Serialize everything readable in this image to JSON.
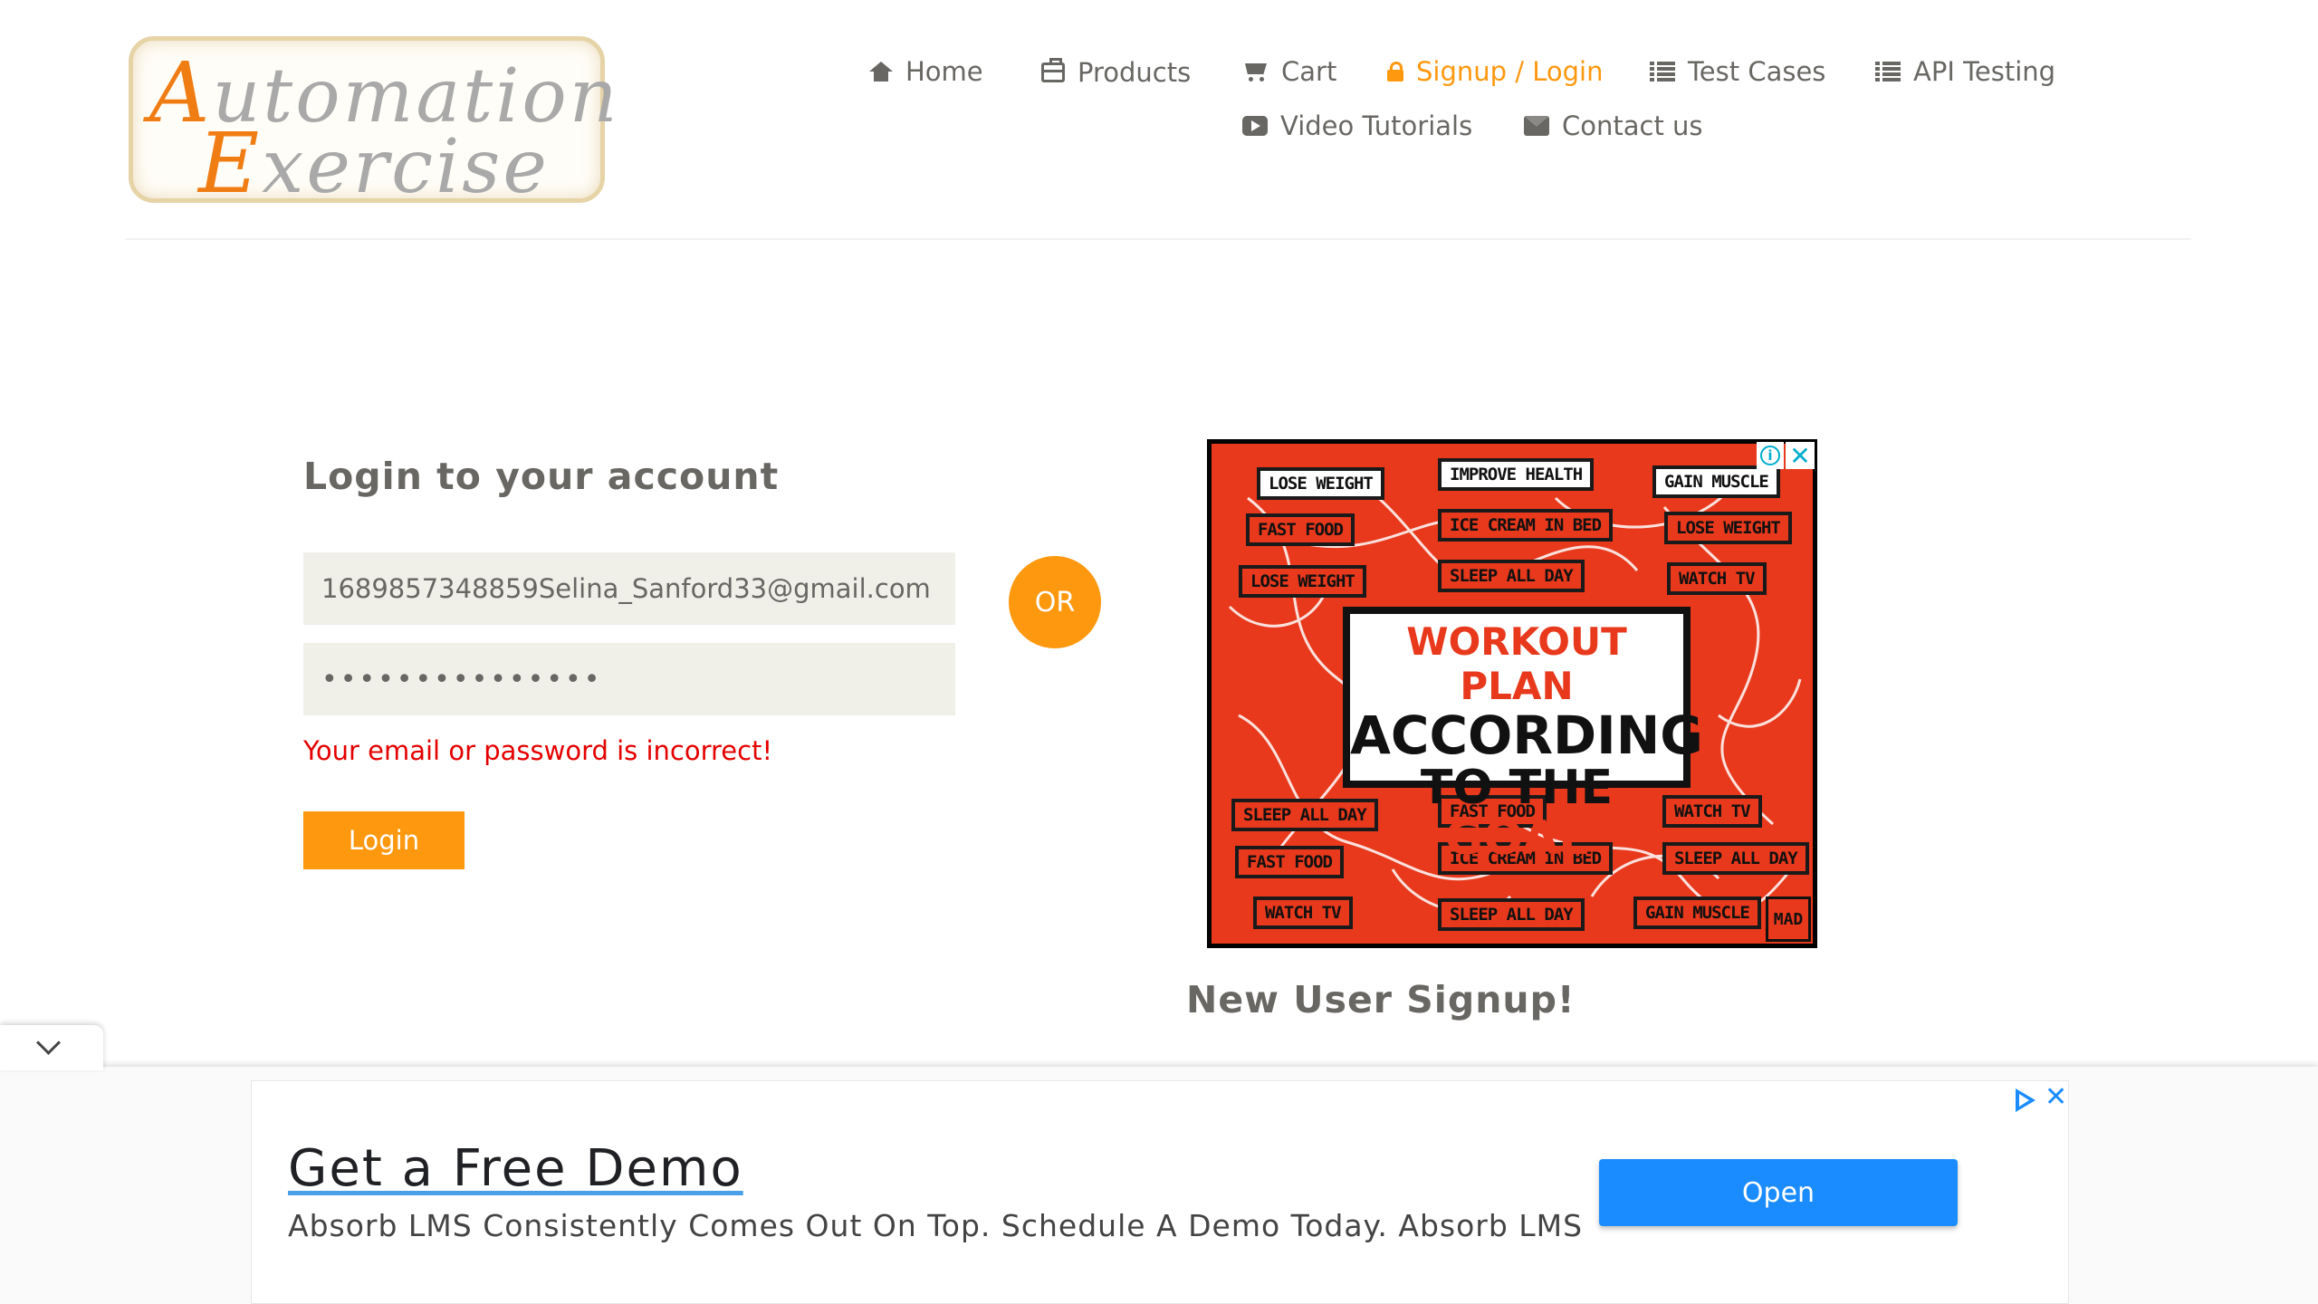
{
  "brand": {
    "logo_word1_first": "A",
    "logo_word1_rest": "utomation",
    "logo_word2_first": "E",
    "logo_word2_rest": "xercise"
  },
  "nav": {
    "home": "Home",
    "products": "Products",
    "cart": "Cart",
    "signup_login": "Signup / Login",
    "test_cases": "Test Cases",
    "api_testing": "API Testing",
    "video_tutorials": "Video Tutorials",
    "contact_us": "Contact us"
  },
  "login": {
    "title": "Login to your account",
    "email_value": "1689857348859Selina_Sanford33@gmail.com",
    "password_value": "•••••••••••••••",
    "error": "Your email or password is incorrect!",
    "button": "Login"
  },
  "or_label": "OR",
  "ad": {
    "headline_1": "WORKOUT PLAN",
    "headline_2": "ACCORDING",
    "headline_3a": "TO THE ",
    "headline_3b": "GOAL",
    "tags": [
      "LOSE WEIGHT",
      "IMPROVE HEALTH",
      "GAIN MUSCLE",
      "FAST FOOD",
      "ICE CREAM IN BED",
      "LOSE WEIGHT",
      "LOSE WEIGHT",
      "SLEEP ALL DAY",
      "WATCH TV",
      "SLEEP ALL DAY",
      "FAST FOOD",
      "WATCH TV",
      "FAST FOOD",
      "ICE CREAM IN BED",
      "SLEEP ALL DAY",
      "WATCH TV",
      "SLEEP ALL DAY",
      "GAIN MUSCLE"
    ],
    "corner_mark": "MAD",
    "info_glyph": "i",
    "close_glyph": "✕"
  },
  "signup": {
    "title": "New User Signup!"
  },
  "bottom_ad": {
    "title": "Get a Free Demo",
    "description": "Absorb LMS Consistently Comes Out On Top. Schedule A Demo Today. Absorb LMS",
    "button": "Open",
    "close_glyph": "✕"
  },
  "colors": {
    "accent": "#fe980f",
    "error": "#e50000",
    "ad_red": "#e8391c",
    "ad_blue": "#1a8cff",
    "text": "#696763"
  }
}
